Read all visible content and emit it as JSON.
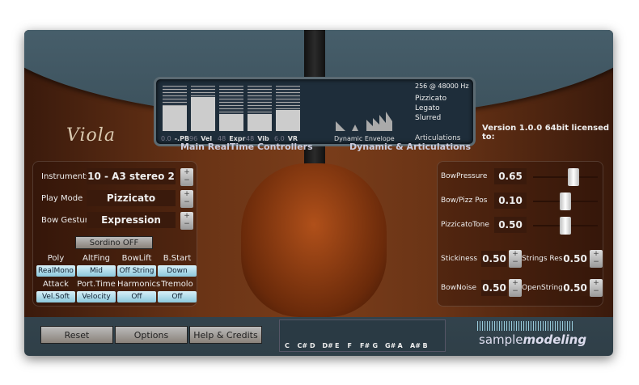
{
  "title": "Viola",
  "version": "Version 1.0.0 64bit  licensed to:",
  "controllers": {
    "label": "Main RealTime Controllers",
    "bars": [
      {
        "name": "-.PB",
        "value": "0.0",
        "level": 0.55
      },
      {
        "name": "Vel",
        "value": "96",
        "level": 0.75
      },
      {
        "name": "Expr",
        "value": "48",
        "level": 0.38
      },
      {
        "name": "Vib",
        "value": "48",
        "level": 0.38
      },
      {
        "name": "VR",
        "value": "6.0",
        "level": 0.47
      }
    ]
  },
  "dynamics": {
    "label": "Dynamic & Articulations",
    "envelope_label": "Dynamic Envelope",
    "buffer": "256 @ 48000 Hz",
    "articulations": [
      "Pizzicato",
      "Legato",
      "Slurred"
    ],
    "articulations_label": "Articulations"
  },
  "left": {
    "rows": [
      {
        "label": "Instruments",
        "value": "10 - A3 stereo 2"
      },
      {
        "label": "Play Mode",
        "value": "Pizzicato"
      },
      {
        "label": "Bow Gesture",
        "value": "Expression"
      }
    ],
    "sordino": "Sordino OFF",
    "options": [
      {
        "label": "Poly",
        "value": "RealMono"
      },
      {
        "label": "AltFing",
        "value": "Mid"
      },
      {
        "label": "BowLift",
        "value": "Off String"
      },
      {
        "label": "B.Start",
        "value": "Down"
      },
      {
        "label": "Attack",
        "value": "Vel.Soft"
      },
      {
        "label": "Port.Time",
        "value": "Velocity"
      },
      {
        "label": "Harmonics",
        "value": "Off"
      },
      {
        "label": "Tremolo",
        "value": "Off"
      }
    ]
  },
  "right": {
    "sliders": [
      {
        "label": "BowPressure",
        "value": "0.65",
        "level": 0.65
      },
      {
        "label": "Bow/Pizz Pos",
        "value": "0.10",
        "level": 0.5
      },
      {
        "label": "PizzicatoTone",
        "value": "0.50",
        "level": 0.5
      }
    ],
    "steppers": [
      {
        "label": "Stickiness",
        "value": "0.50"
      },
      {
        "label": "Strings Res.",
        "value": "0.50"
      },
      {
        "label": "BowNoise",
        "value": "0.50"
      },
      {
        "label": "OpenStrings",
        "value": "0.50"
      }
    ]
  },
  "bottom": {
    "reset": "Reset",
    "options": "Options",
    "help": "Help & Credits",
    "keys": [
      "C",
      "C#",
      "D",
      "D#",
      "E",
      "F",
      "F#",
      "G",
      "G#",
      "A",
      "A#",
      "B"
    ],
    "logo_a": "sample",
    "logo_b": "modeling"
  },
  "colors": {
    "led": "#44dd33",
    "accent": "#8cc8dc"
  }
}
